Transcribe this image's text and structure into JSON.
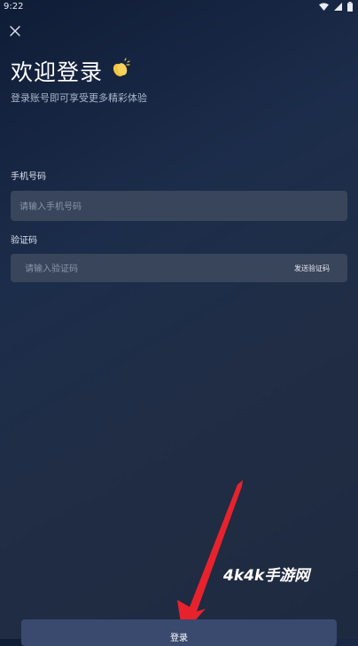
{
  "status_bar": {
    "time": "9:22",
    "icons": [
      "wifi-icon",
      "signal-icon",
      "battery-icon"
    ]
  },
  "header": {
    "close_icon": "close-icon",
    "title": "欢迎登录",
    "title_emoji_icon": "clapping-hands-icon",
    "subtitle": "登录账号即可享受更多精彩体验"
  },
  "form": {
    "phone": {
      "label": "手机号码",
      "placeholder": "请输入手机号码",
      "value": ""
    },
    "code": {
      "label": "验证码",
      "placeholder": "请输入验证码",
      "value": "",
      "send_label": "发送验证码"
    }
  },
  "login_button": {
    "label": "登录"
  },
  "overlay": {
    "watermark": "4k4k手游网",
    "arrow_color": "#e8222d"
  },
  "colors": {
    "background": "#1c2d4b",
    "input_background": "#39455a",
    "button_background": "#3a4a6e",
    "subtitle_text": "#aab6c9"
  }
}
